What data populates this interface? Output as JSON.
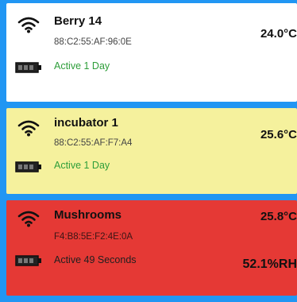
{
  "devices": [
    {
      "name": "Berry 14",
      "mac": "88:C2:55:AF:96:0E",
      "status": "Active 1 Day",
      "temperature": "24.0°C",
      "card_color": "#ffffff",
      "status_color": "#2E9E3A",
      "signal_icon": "wifi-icon",
      "battery_icon": "battery-icon"
    },
    {
      "name": "incubator 1",
      "mac": "88:C2:55:AF:F7:A4",
      "status": "Active 1 Day",
      "temperature": "25.6°C",
      "card_color": "#F5F19D",
      "status_color": "#2E9E3A",
      "signal_icon": "wifi-icon",
      "battery_icon": "battery-icon"
    },
    {
      "name": "Mushrooms",
      "mac": "F4:B8:5E:F2:4E:0A",
      "status": "Active 49 Seconds",
      "temperature": "25.8°C",
      "humidity": "52.1%RH",
      "card_color": "#E53935",
      "status_color": "#1f1f1f",
      "signal_icon": "wifi-icon",
      "battery_icon": "battery-icon"
    }
  ],
  "colors": {
    "background": "#2196F3",
    "text": "#111111"
  }
}
